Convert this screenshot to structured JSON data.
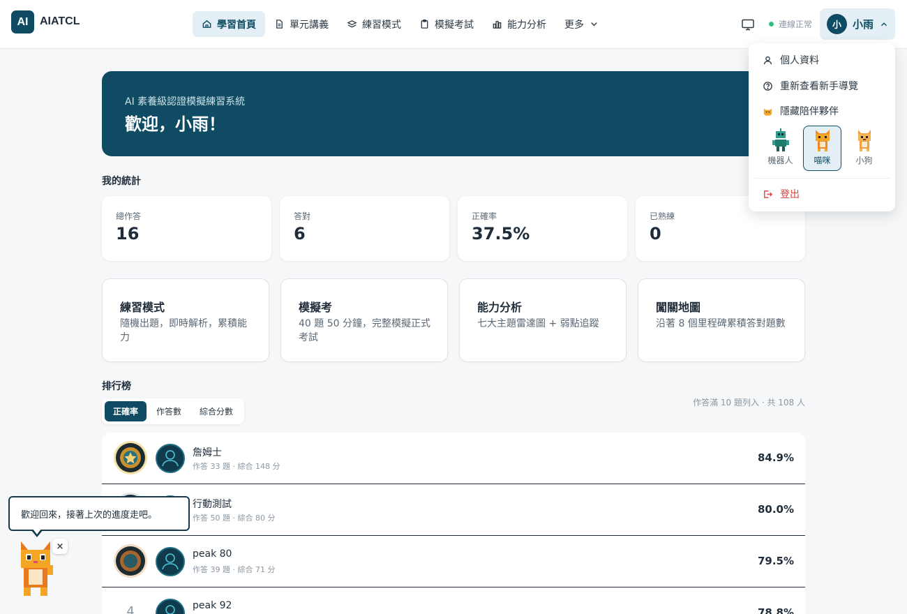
{
  "app": {
    "logo_text": "AI",
    "brand": "AIATCL"
  },
  "nav": [
    {
      "label": "學習首頁",
      "icon": "home-icon",
      "active": true
    },
    {
      "label": "單元講義",
      "icon": "document-icon",
      "active": false
    },
    {
      "label": "練習模式",
      "icon": "layers-icon",
      "active": false
    },
    {
      "label": "模擬考試",
      "icon": "clipboard-icon",
      "active": false
    },
    {
      "label": "能力分析",
      "icon": "bar-chart-icon",
      "active": false
    },
    {
      "label": "更多",
      "icon": "chevron-down-icon",
      "active": false
    }
  ],
  "header": {
    "status": "連線正常",
    "status_color": "#2ec27e",
    "user_initial": "小",
    "user_name": "小雨"
  },
  "dropdown": {
    "profile": "個人資料",
    "tour": "重新查看新手導覽",
    "hide_companion": "隱藏陪伴夥伴",
    "pets": [
      {
        "label": "機器人",
        "selected": false
      },
      {
        "label": "喵咪",
        "selected": true
      },
      {
        "label": "小狗",
        "selected": false
      }
    ],
    "logout": "登出"
  },
  "banner": {
    "subtitle": "AI 素養級認證模擬練習系統",
    "title": "歡迎，小雨！"
  },
  "stats_title": "我的統計",
  "stats": [
    {
      "label": "總作答",
      "value": "16"
    },
    {
      "label": "答對",
      "value": "6"
    },
    {
      "label": "正確率",
      "value": "37.5%"
    },
    {
      "label": "已熟練",
      "value": "0"
    }
  ],
  "features": [
    {
      "title": "練習模式",
      "desc": "隨機出題，即時解析，累積能力"
    },
    {
      "title": "模擬考",
      "desc": "40 題 50 分鐘，完整模擬正式考試"
    },
    {
      "title": "能力分析",
      "desc": "七大主題雷達圖 + 弱點追蹤"
    },
    {
      "title": "闖關地圖",
      "desc": "沿著 8 個里程碑累積答對題數"
    }
  ],
  "leaderboard": {
    "title": "排行榜",
    "tabs": [
      "正確率",
      "作答數",
      "綜合分數"
    ],
    "active_tab": 0,
    "note": "作答滿 10 題列入 · 共 108 人",
    "rows": [
      {
        "rank": "1",
        "name": "詹姆士",
        "meta": "作答 33 題 · 綜合 148 分",
        "score": "84.9%",
        "badge": "gold"
      },
      {
        "rank": "2",
        "name": "行動測試",
        "meta": "作答 50 題 · 綜合 80 分",
        "score": "80.0%",
        "badge": "silver"
      },
      {
        "rank": "3",
        "name": "peak 80",
        "meta": "作答 39 題 · 綜合 71 分",
        "score": "79.5%",
        "badge": "bronze"
      },
      {
        "rank": "4",
        "name": "peak 92",
        "meta": "",
        "score": "78.8%",
        "badge": "none"
      }
    ]
  },
  "companion": {
    "message": "歡迎回來，接著上次的進度走吧。",
    "close": "×"
  },
  "colors": {
    "primary": "#0f4c63",
    "logout": "#d9433b"
  }
}
